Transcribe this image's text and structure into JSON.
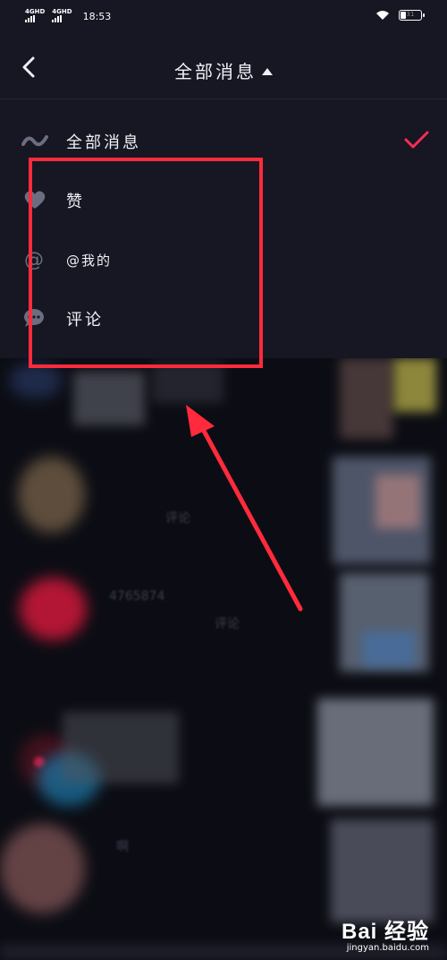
{
  "status_bar": {
    "network_1": "4GHD",
    "network_2": "4GHD",
    "time": "18:53",
    "battery_label": "31"
  },
  "header": {
    "title": "全部消息"
  },
  "menu": {
    "items": [
      {
        "label": "全部消息",
        "icon": "wave-icon",
        "selected": true
      },
      {
        "label": "赞",
        "icon": "heart-icon",
        "selected": false
      },
      {
        "label": "@我的",
        "icon": "at-icon",
        "selected": false
      },
      {
        "label": "评论",
        "icon": "comment-icon",
        "selected": false
      }
    ]
  },
  "feed_blurred_text": {
    "line_1": "评论",
    "line_2": "4765874",
    "line_3": "评论",
    "line_4": "啊"
  },
  "colors": {
    "accent": "#fe2c55",
    "annotation": "#ff2b3c",
    "background": "#161722"
  },
  "watermark": {
    "main": "Bai 经验",
    "sub": "jingyan.baidu.com"
  }
}
